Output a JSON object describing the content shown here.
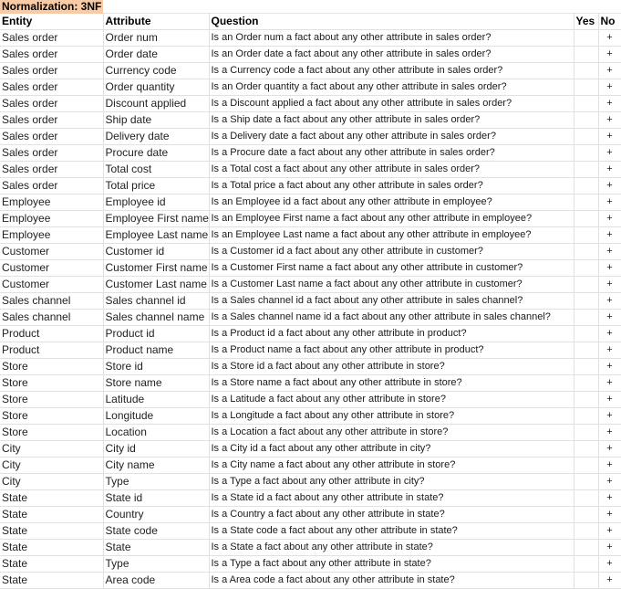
{
  "sheet": {
    "title": "Normalization: 3NF",
    "headers": {
      "entity": "Entity",
      "attribute": "Attribute",
      "question": "Question",
      "yes": "Yes",
      "no": "No"
    },
    "rows": [
      {
        "entity": "Sales order",
        "attribute": "Order num",
        "question": "Is an Order num a fact about any other attribute in sales order?",
        "yes": "",
        "no": "+"
      },
      {
        "entity": "Sales order",
        "attribute": "Order date",
        "question": "Is an Order date a fact about any other attribute in sales order?",
        "yes": "",
        "no": "+"
      },
      {
        "entity": "Sales order",
        "attribute": "Currency code",
        "question": "Is a Currency code a fact about any other attribute in sales order?",
        "yes": "",
        "no": "+"
      },
      {
        "entity": "Sales order",
        "attribute": "Order quantity",
        "question": "Is an Order quantity a fact about any other attribute in sales order?",
        "yes": "",
        "no": "+"
      },
      {
        "entity": "Sales order",
        "attribute": "Discount applied",
        "question": "Is a Discount applied a fact about any other attribute in sales order?",
        "yes": "",
        "no": "+"
      },
      {
        "entity": "Sales order",
        "attribute": "Ship date",
        "question": "Is a Ship date a fact about any other attribute in sales order?",
        "yes": "",
        "no": "+"
      },
      {
        "entity": "Sales order",
        "attribute": "Delivery date",
        "question": "Is a Delivery date a fact about any other attribute in sales order?",
        "yes": "",
        "no": "+"
      },
      {
        "entity": "Sales order",
        "attribute": "Procure date",
        "question": "Is a Procure date a fact about any other attribute in sales order?",
        "yes": "",
        "no": "+"
      },
      {
        "entity": "Sales order",
        "attribute": "Total cost",
        "question": "Is a Total cost a fact about any other attribute in sales order?",
        "yes": "",
        "no": "+"
      },
      {
        "entity": "Sales order",
        "attribute": "Total price",
        "question": "Is a Total price a fact about any other attribute in sales order?",
        "yes": "",
        "no": "+"
      },
      {
        "entity": "Employee",
        "attribute": "Employee id",
        "question": "Is an Employee id a fact about any other attribute in employee?",
        "yes": "",
        "no": "+"
      },
      {
        "entity": "Employee",
        "attribute": "Employee First name",
        "question": "Is an Employee First name a fact about any other attribute in employee?",
        "yes": "",
        "no": "+"
      },
      {
        "entity": "Employee",
        "attribute": "Employee Last name",
        "question": "Is an Employee Last name a fact about any other attribute in employee?",
        "yes": "",
        "no": "+"
      },
      {
        "entity": "Customer",
        "attribute": "Customer id",
        "question": "Is a Customer id a fact about any other attribute in customer?",
        "yes": "",
        "no": "+"
      },
      {
        "entity": "Customer",
        "attribute": "Customer First name",
        "question": "Is a Customer First name a fact about any other attribute in customer?",
        "yes": "",
        "no": "+"
      },
      {
        "entity": "Customer",
        "attribute": "Customer Last name",
        "question": "Is a Customer Last name a fact about any other attribute in customer?",
        "yes": "",
        "no": "+"
      },
      {
        "entity": "Sales channel",
        "attribute": "Sales channel id",
        "question": "Is a Sales channel id a fact about any other attribute in sales channel?",
        "yes": "",
        "no": "+"
      },
      {
        "entity": "Sales channel",
        "attribute": "Sales channel name",
        "question": "Is a Sales channel name id a fact about any other attribute in sales channel?",
        "yes": "",
        "no": "+"
      },
      {
        "entity": "Product",
        "attribute": "Product id",
        "question": "Is a Product id a fact about any other attribute in product?",
        "yes": "",
        "no": "+"
      },
      {
        "entity": "Product",
        "attribute": "Product name",
        "question": "Is a Product name a fact about any other attribute in product?",
        "yes": "",
        "no": "+"
      },
      {
        "entity": "Store",
        "attribute": "Store id",
        "question": "Is a Store id a fact about any other attribute in store?",
        "yes": "",
        "no": "+"
      },
      {
        "entity": "Store",
        "attribute": "Store name",
        "question": "Is a Store name a fact about any other attribute in store?",
        "yes": "",
        "no": "+"
      },
      {
        "entity": "Store",
        "attribute": "Latitude",
        "question": "Is a Latitude a fact about any other attribute in store?",
        "yes": "",
        "no": "+"
      },
      {
        "entity": "Store",
        "attribute": "Longitude",
        "question": "Is a Longitude a fact about any other attribute in store?",
        "yes": "",
        "no": "+"
      },
      {
        "entity": "Store",
        "attribute": "Location",
        "question": "Is a Location a fact about any other attribute in store?",
        "yes": "",
        "no": "+"
      },
      {
        "entity": "City",
        "attribute": "City id",
        "question": "Is a City id a fact about any other attribute in city?",
        "yes": "",
        "no": "+"
      },
      {
        "entity": "City",
        "attribute": "City name",
        "question": "Is a City name a fact about any other attribute in store?",
        "yes": "",
        "no": "+"
      },
      {
        "entity": "City",
        "attribute": "Type",
        "question": "Is a Type a fact about any other attribute in city?",
        "yes": "",
        "no": "+"
      },
      {
        "entity": "State",
        "attribute": "State id",
        "question": "Is a State id a fact about any other attribute in state?",
        "yes": "",
        "no": "+"
      },
      {
        "entity": "State",
        "attribute": "Country",
        "question": "Is a Country a fact about any other attribute in state?",
        "yes": "",
        "no": "+"
      },
      {
        "entity": "State",
        "attribute": "State code",
        "question": "Is a State code a fact about any other attribute in state?",
        "yes": "",
        "no": "+"
      },
      {
        "entity": "State",
        "attribute": "State",
        "question": "Is a State a fact about any other attribute in state?",
        "yes": "",
        "no": "+"
      },
      {
        "entity": "State",
        "attribute": "Type",
        "question": "Is a Type a fact about any other attribute in state?",
        "yes": "",
        "no": "+"
      },
      {
        "entity": "State",
        "attribute": "Area code",
        "question": "Is a Area code a fact about any other attribute in state?",
        "yes": "",
        "no": "+"
      }
    ],
    "colors": {
      "title_fill": "#f8cba6",
      "grid": "#e1e1e1"
    }
  }
}
